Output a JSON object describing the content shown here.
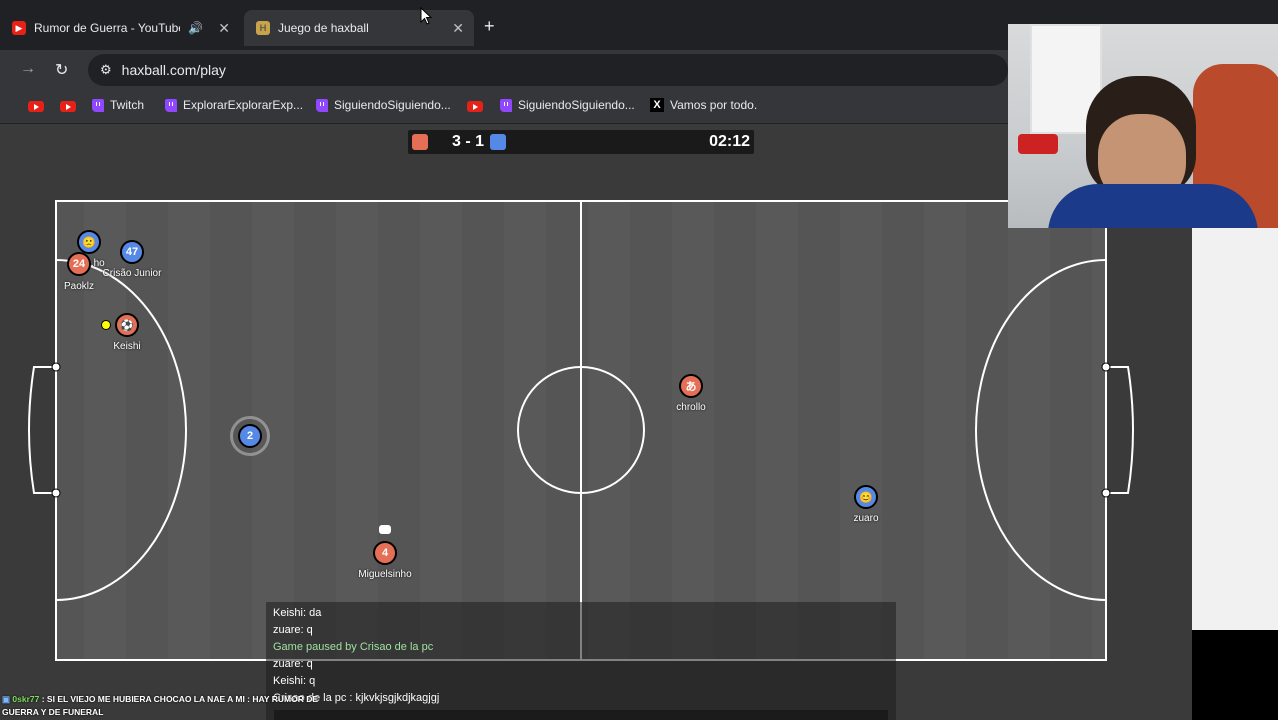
{
  "browser": {
    "tabs": [
      {
        "title": "Rumor de Guerra - YouTube",
        "close": "✕"
      },
      {
        "title": "Juego de haxball",
        "close": "✕"
      }
    ],
    "new_tab": "+",
    "url": "haxball.com/play",
    "bookmarks": [
      {
        "label": "Twitch"
      },
      {
        "label": "ExplorarExplorarExp..."
      },
      {
        "label": "SiguiendoSiguiendo..."
      },
      {
        "label": "SiguiendoSiguiendo..."
      },
      {
        "label": "Vamos por todo."
      }
    ]
  },
  "scoreboard": {
    "score": "3 - 1",
    "time": "02:12",
    "red_color": "#e56e56",
    "blue_color": "#5689e5"
  },
  "players": [
    {
      "name": "...ho",
      "avatar": "🙁",
      "team": "blue"
    },
    {
      "name": "Crisão Junior",
      "avatar": "47",
      "team": "blue"
    },
    {
      "name": "Paoklz",
      "avatar": "24",
      "team": "red"
    },
    {
      "name": "Keishi",
      "avatar": "⚽",
      "team": "red"
    },
    {
      "name": "",
      "avatar": "2",
      "team": "blue"
    },
    {
      "name": "chrollo",
      "avatar": "あ",
      "team": "red"
    },
    {
      "name": "zuaro",
      "avatar": "😊",
      "team": "blue"
    },
    {
      "name": "Miguelsinho",
      "avatar": "4",
      "team": "red"
    }
  ],
  "chat": {
    "lines": [
      {
        "text": "Keishi: da",
        "type": "msg"
      },
      {
        "text": "zuare: q",
        "type": "msg"
      },
      {
        "text": "Game paused by Crisao de la pc",
        "type": "system"
      },
      {
        "text": "zuare: q",
        "type": "msg"
      },
      {
        "text": "Keishi: q",
        "type": "msg"
      },
      {
        "text": "Crisao de la pc : kjkvkjsgjkdjkagjgj",
        "type": "msg"
      }
    ]
  },
  "stream_overlay": {
    "user": "0skr77",
    "message": ": SI EL VIEJO ME HUBIERA CHOCAO LA NAE A MI : HAY RUMOR DE GUERRA Y DE FUNERAL"
  }
}
